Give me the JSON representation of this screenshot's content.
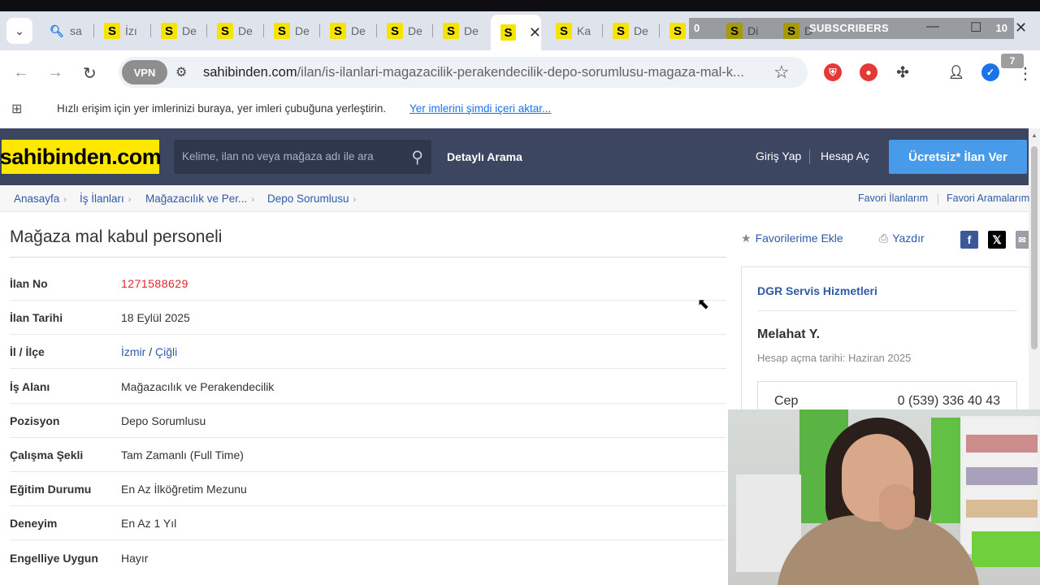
{
  "browser": {
    "tabs": [
      {
        "icon": "search-icon",
        "label": "sa"
      },
      {
        "icon": "S",
        "label": "İzı"
      },
      {
        "icon": "S",
        "label": "De"
      },
      {
        "icon": "S",
        "label": "De"
      },
      {
        "icon": "S",
        "label": "De"
      },
      {
        "icon": "S",
        "label": "De"
      },
      {
        "icon": "S",
        "label": "De"
      },
      {
        "icon": "S",
        "label": "De"
      },
      {
        "icon": "S",
        "label": ""
      },
      {
        "icon": "S",
        "label": "Ka"
      },
      {
        "icon": "S",
        "label": "De"
      },
      {
        "icon": "S",
        "label": ""
      },
      {
        "icon": "S",
        "label": "Di"
      },
      {
        "icon": "S",
        "label": "D"
      }
    ],
    "overlay": {
      "count_left": "0",
      "label": "SUBSCRIBERS",
      "count_right": "10"
    },
    "vpn_label": "VPN",
    "url_host": "sahibinden.com",
    "url_path": "/ilan/is-ilanlari-magazacilik-perakendecilik-depo-sorumlusu-magaza-mal-k...",
    "ext_badge": "7",
    "bookmarks_text": "Hızlı erişim için yer imlerinizi buraya, yer imleri çubuğuna yerleştirin.",
    "bookmarks_link": "Yer imlerini şimdi içeri aktar..."
  },
  "site": {
    "logo": "sahibinden.com",
    "search_placeholder": "Kelime, ilan no veya mağaza adı ile ara",
    "detailed_search": "Detaylı Arama",
    "login": "Giriş Yap",
    "register": "Hesap Aç",
    "post_ad": "Ücretsiz* İlan Ver"
  },
  "breadcrumb": {
    "items": [
      "Anasayfa",
      "İş İlanları",
      "Mağazacılık ve Per...",
      "Depo Sorumlusu"
    ],
    "right": [
      "Favori İlanlarım",
      "Favori Aramalarım"
    ]
  },
  "listing": {
    "title": "Mağaza mal kabul personeli",
    "add_favorite": "Favorilerime Ekle",
    "print": "Yazdır",
    "fields": [
      {
        "key": "İlan No",
        "value": "1271588629"
      },
      {
        "key": "İlan Tarihi",
        "value": "18 Eylül 2025"
      },
      {
        "key": "İl / İlçe",
        "city": "İzmir",
        "sep": " / ",
        "district": "Çiğli"
      },
      {
        "key": "İş Alanı",
        "value": "Mağazacılık ve Perakendecilik"
      },
      {
        "key": "Pozisyon",
        "value": "Depo Sorumlusu"
      },
      {
        "key": "Çalışma Şekli",
        "value": "Tam Zamanlı (Full Time)"
      },
      {
        "key": "Eğitim Durumu",
        "value": "En Az İlköğretim Mezunu"
      },
      {
        "key": "Deneyim",
        "value": "En Az 1 Yıl"
      },
      {
        "key": "Engelliye Uygun",
        "value": "Hayır"
      }
    ]
  },
  "seller": {
    "company": "DGR Servis Hizmetleri",
    "name": "Melahat Y.",
    "since": "Hesap açma tarihi: Haziran 2025",
    "phone_label": "Cep",
    "phone": "0 (539) 336 40 43"
  },
  "colors": {
    "header_bg": "#3c4661",
    "logo_bg": "#ffe800",
    "cta_bg": "#489be8",
    "link": "#2f5aa8",
    "ad_no": "#e3242b"
  }
}
